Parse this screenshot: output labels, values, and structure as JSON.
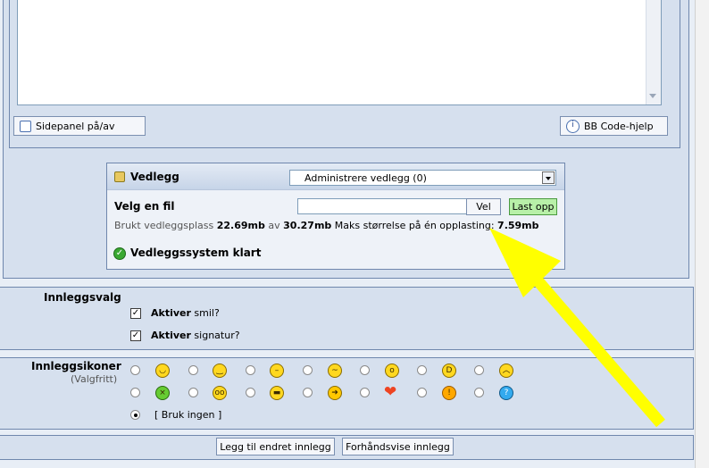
{
  "editor": {
    "sidepanel_label": "Sidepanel på/av",
    "bbcode_label": "BB Code-hjelp"
  },
  "attachments": {
    "title": "Vedlegg",
    "manage_select": "Administrere vedlegg (0)",
    "choose_file_label": "Velg en fil",
    "browse_label": "Vel",
    "upload_label": "Last opp",
    "usage_prefix": "Brukt vedleggsplass",
    "used": "22.69mb",
    "of": "av",
    "total": "30.27mb",
    "max_label": "Maks størrelse på én opplasting:",
    "max_value": "7.59mb",
    "status": "Vedleggssystem klart"
  },
  "post_options": {
    "title": "Innleggsvalg",
    "option1_bold": "Aktiver",
    "option1_rest": "smil?",
    "option2_bold": "Aktiver",
    "option2_rest": "signatur?"
  },
  "post_icons": {
    "title": "Innleggsikoner",
    "subtitle": "(Valgfritt)",
    "none_label": "[ Bruk ingen ]",
    "row1": [
      "smile-icon",
      "cool-icon",
      "tired-icon",
      "wink-icon",
      "shocked-icon",
      "grin-icon",
      "angry-icon"
    ],
    "row2": [
      "sick-icon",
      "confused-icon",
      "sunglasses-icon",
      "arrow-icon",
      "heart-icon",
      "warning-icon",
      "question-icon"
    ]
  },
  "footer": {
    "submit_label": "Legg til endret innlegg",
    "preview_label": "Forhåndsvise innlegg"
  },
  "colors": {
    "panel_bg": "#d6e0ee",
    "border": "#6f87ad",
    "arrow": "#ffff00",
    "upload_bg": "#b8f0a8"
  }
}
